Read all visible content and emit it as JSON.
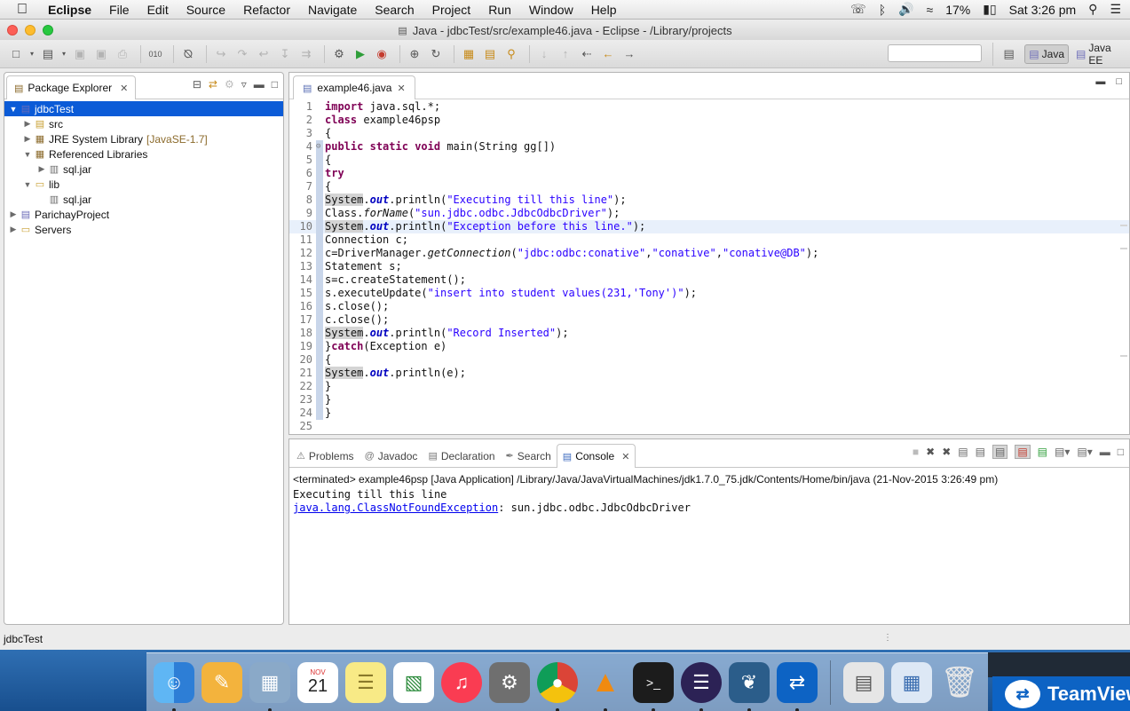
{
  "menubar": {
    "app_name": "Eclipse",
    "items": [
      "File",
      "Edit",
      "Source",
      "Refactor",
      "Navigate",
      "Search",
      "Project",
      "Run",
      "Window",
      "Help"
    ],
    "battery": "17%",
    "clock": "Sat 3:26 pm"
  },
  "window": {
    "title": "Java - jdbcTest/src/example46.java - Eclipse - /Library/projects"
  },
  "perspectives": {
    "java": "Java",
    "java_ee": "Java EE"
  },
  "package_explorer": {
    "tab_label": "Package Explorer",
    "tree": [
      {
        "label": "jdbcTest",
        "icon": "project-icon",
        "level": 0,
        "expanded": true,
        "selected": true
      },
      {
        "label": "src",
        "icon": "package-folder-icon",
        "level": 1,
        "expanded": false
      },
      {
        "label": "JRE System Library",
        "sub": "[JavaSE-1.7]",
        "icon": "library-icon",
        "level": 1,
        "expanded": false
      },
      {
        "label": "Referenced Libraries",
        "icon": "library-icon",
        "level": 1,
        "expanded": true
      },
      {
        "label": "sql.jar",
        "icon": "jar-icon",
        "level": 2,
        "expanded": false
      },
      {
        "label": "lib",
        "icon": "folder-icon",
        "level": 1,
        "expanded": true
      },
      {
        "label": "sql.jar",
        "icon": "jar-icon",
        "level": 2,
        "leaf": true
      },
      {
        "label": "ParichayProject",
        "icon": "project-icon",
        "level": 0,
        "expanded": false
      },
      {
        "label": "Servers",
        "icon": "folder-icon",
        "level": 0,
        "expanded": false
      }
    ]
  },
  "editor": {
    "tab_label": "example46.java",
    "current_line": 10,
    "lines": [
      "import java.sql.*;",
      "class example46psp",
      "{",
      "public static void main(String gg[])",
      "{",
      "try",
      "{",
      "System.out.println(\"Executing till this line\");",
      "Class.forName(\"sun.jdbc.odbc.JdbcOdbcDriver\");",
      "System.out.println(\"Exception before this line.\");",
      "Connection c;",
      "c=DriverManager.getConnection(\"jdbc:odbc:conative\",\"conative\",\"conative@DB\");",
      "Statement s;",
      "s=c.createStatement();",
      "s.executeUpdate(\"insert into student values(231,'Tony')\");",
      "s.close();",
      "c.close();",
      "System.out.println(\"Record Inserted\");",
      "}catch(Exception e)",
      "{",
      "System.out.println(e);",
      "}",
      "}",
      "}",
      ""
    ]
  },
  "bottom_panel": {
    "tabs": [
      "Problems",
      "Javadoc",
      "Declaration",
      "Search",
      "Console"
    ],
    "active_tab": "Console",
    "terminated_line": "<terminated> example46psp [Java Application] /Library/Java/JavaVirtualMachines/jdk1.7.0_75.jdk/Contents/Home/bin/java (21-Nov-2015 3:26:49 pm)",
    "output_line_1": "Executing till this line",
    "exception_link": "java.lang.ClassNotFoundException",
    "exception_rest": ": sun.jdbc.odbc.JdbcOdbcDriver"
  },
  "status_bar": {
    "text": "jdbcTest"
  },
  "dock": {
    "calendar_month": "NOV",
    "calendar_day": "21",
    "teamviewer_label": "TeamViewer"
  }
}
